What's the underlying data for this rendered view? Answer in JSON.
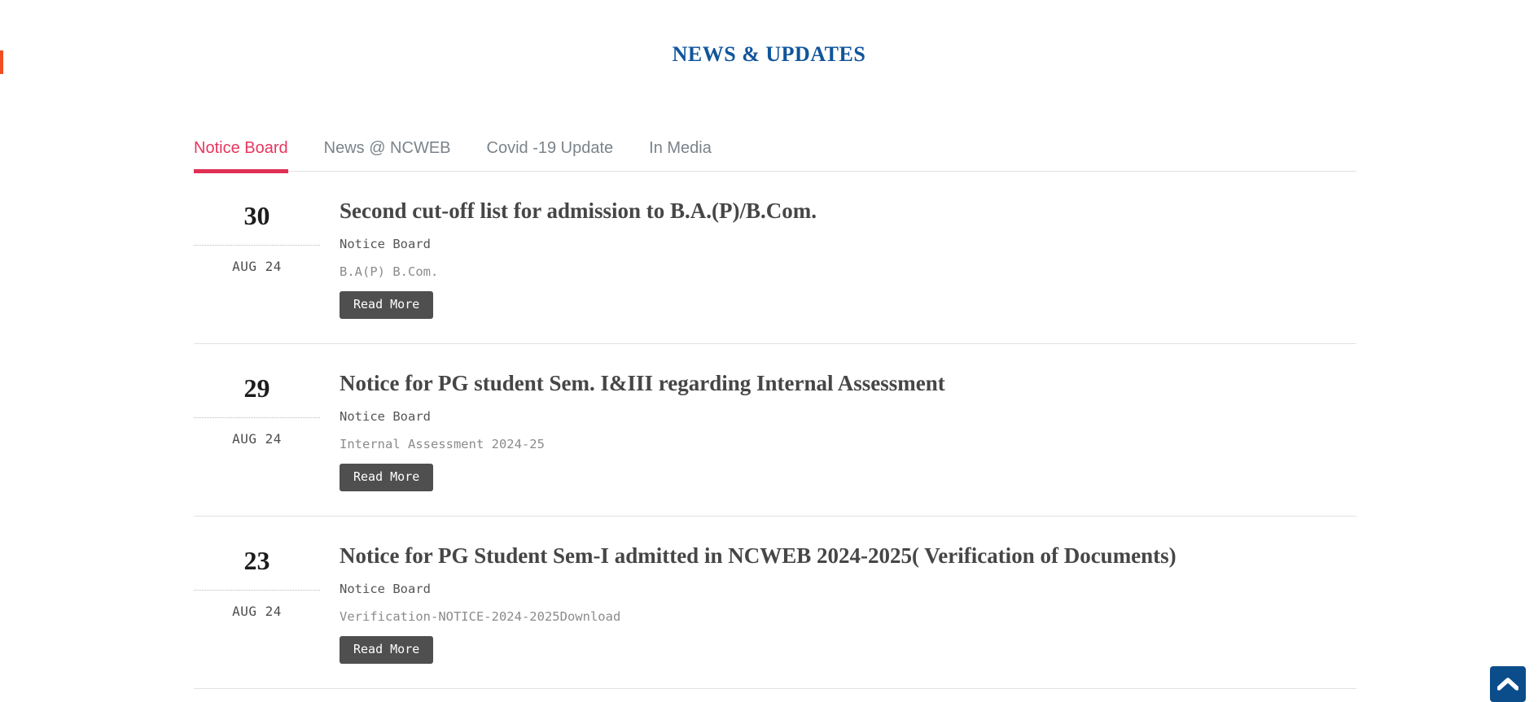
{
  "page": {
    "title": "NEWS & UPDATES",
    "accent_orange": "#f04e23",
    "title_color": "#11559b"
  },
  "tabs": {
    "active_color": "#e8355e",
    "items": [
      {
        "label": "Notice Board",
        "active": true
      },
      {
        "label": "News @ NCWEB",
        "active": false
      },
      {
        "label": "Covid -19 Update",
        "active": false
      },
      {
        "label": "In Media",
        "active": false
      }
    ]
  },
  "news": {
    "read_more_label": "Read More",
    "items": [
      {
        "day": "30",
        "month_year": "AUG 24",
        "title": "Second cut-off list for admission to B.A.(P)/B.Com.",
        "category": "Notice Board",
        "excerpt": "B.A(P) B.Com."
      },
      {
        "day": "29",
        "month_year": "AUG 24",
        "title": "Notice for PG student Sem. I&III regarding Internal Assessment",
        "category": "Notice Board",
        "excerpt": "Internal Assessment 2024-25"
      },
      {
        "day": "23",
        "month_year": "AUG 24",
        "title": "Notice for PG Student Sem-I admitted in NCWEB 2024-2025( Verification of Documents)",
        "category": "Notice Board",
        "excerpt": "Verification-NOTICE-2024-2025Download"
      }
    ]
  },
  "scroll_top": {
    "icon": "chevron-up-icon",
    "color": "#0b4d8a"
  }
}
